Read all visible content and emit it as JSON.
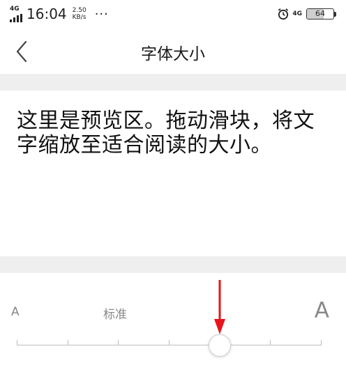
{
  "status_bar": {
    "signal_label": "4G",
    "time": "16:04",
    "speed_value": "2.50",
    "speed_unit": "KB/s",
    "more": "···",
    "network": "4G",
    "battery": "64",
    "battery_level": 64
  },
  "header": {
    "title": "字体大小"
  },
  "preview": {
    "text": "这里是预览区。拖动滑块，将文字缩放至适合阅读的大小。"
  },
  "slider": {
    "small_label": "A",
    "standard_label": "标准",
    "large_label": "A",
    "steps": 7,
    "selected_step": 4
  },
  "colors": {
    "separator": "#efefef",
    "track": "#bdbdbd",
    "arrow": "#e8141b"
  }
}
